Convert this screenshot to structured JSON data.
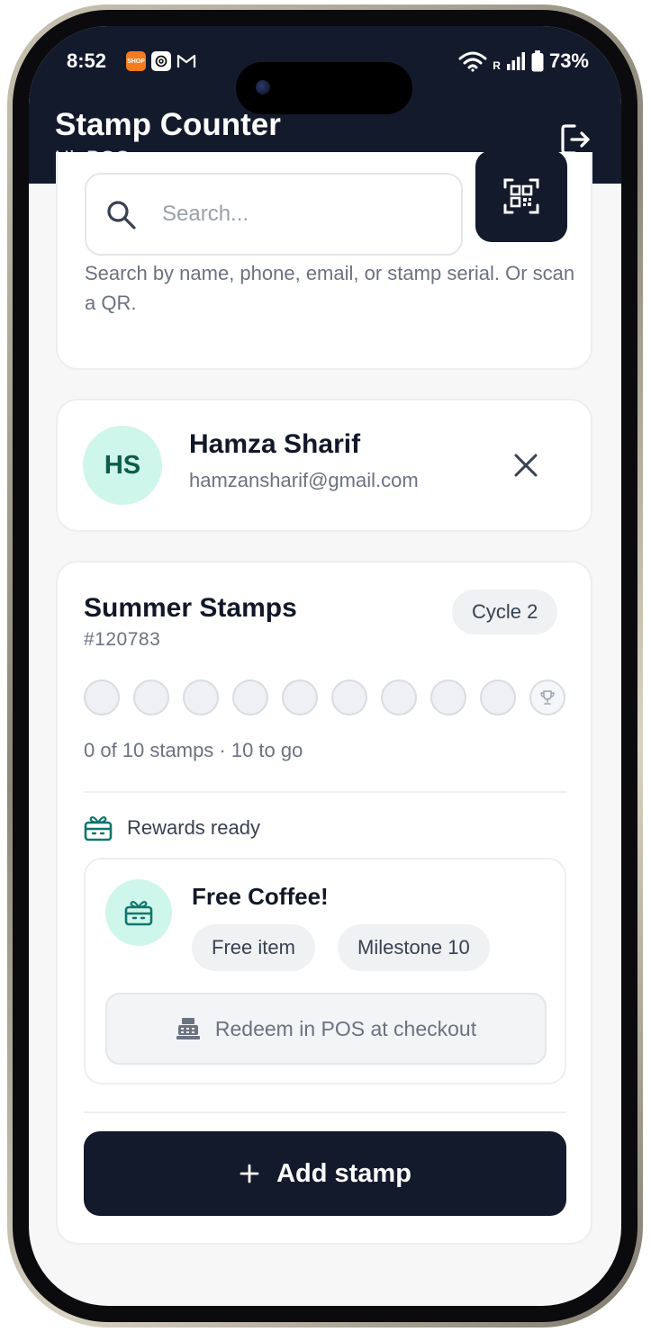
{
  "status_bar": {
    "time": "8:52",
    "battery": "73%",
    "apps": [
      {
        "name": "shop-app",
        "color": "#f47c1f",
        "label": "SHOP"
      },
      {
        "name": "chatgpt-app",
        "color": "#ffffff",
        "label": ""
      },
      {
        "name": "gmail-app",
        "color": "#131a2b",
        "label": ""
      }
    ],
    "network_label": "R"
  },
  "header": {
    "title": "Stamp Counter",
    "greeting": "Hi, POS",
    "logout_icon": "logout-icon",
    "bg_color": "#131a2b"
  },
  "search": {
    "placeholder": "Search...",
    "hint": "Search by name, phone, email, or stamp serial. Or scan a QR.",
    "search_icon": "search-icon",
    "qr_icon": "qr-scan-icon"
  },
  "customer": {
    "initials": "HS",
    "name": "Hamza Sharif",
    "email": "hamzansharif@gmail.com",
    "close_icon": "close-icon"
  },
  "program": {
    "name": "Summer Stamps",
    "serial": "#120783",
    "cycle": "Cycle 2",
    "stamps_filled": 0,
    "stamps_total": 10,
    "progress_text": "0 of 10 stamps · 10 to go",
    "rewards_heading": "Rewards ready",
    "reward": {
      "title": "Free Coffee!",
      "chips": [
        "Free item",
        "Milestone 10"
      ],
      "redeem_label": "Redeem in POS at checkout"
    },
    "add_stamp_label": "Add stamp"
  },
  "colors": {
    "accent_dark": "#131a2b",
    "mint": "#cff6ea",
    "mint_text": "#0d5c48",
    "muted_text": "#6b7280"
  }
}
